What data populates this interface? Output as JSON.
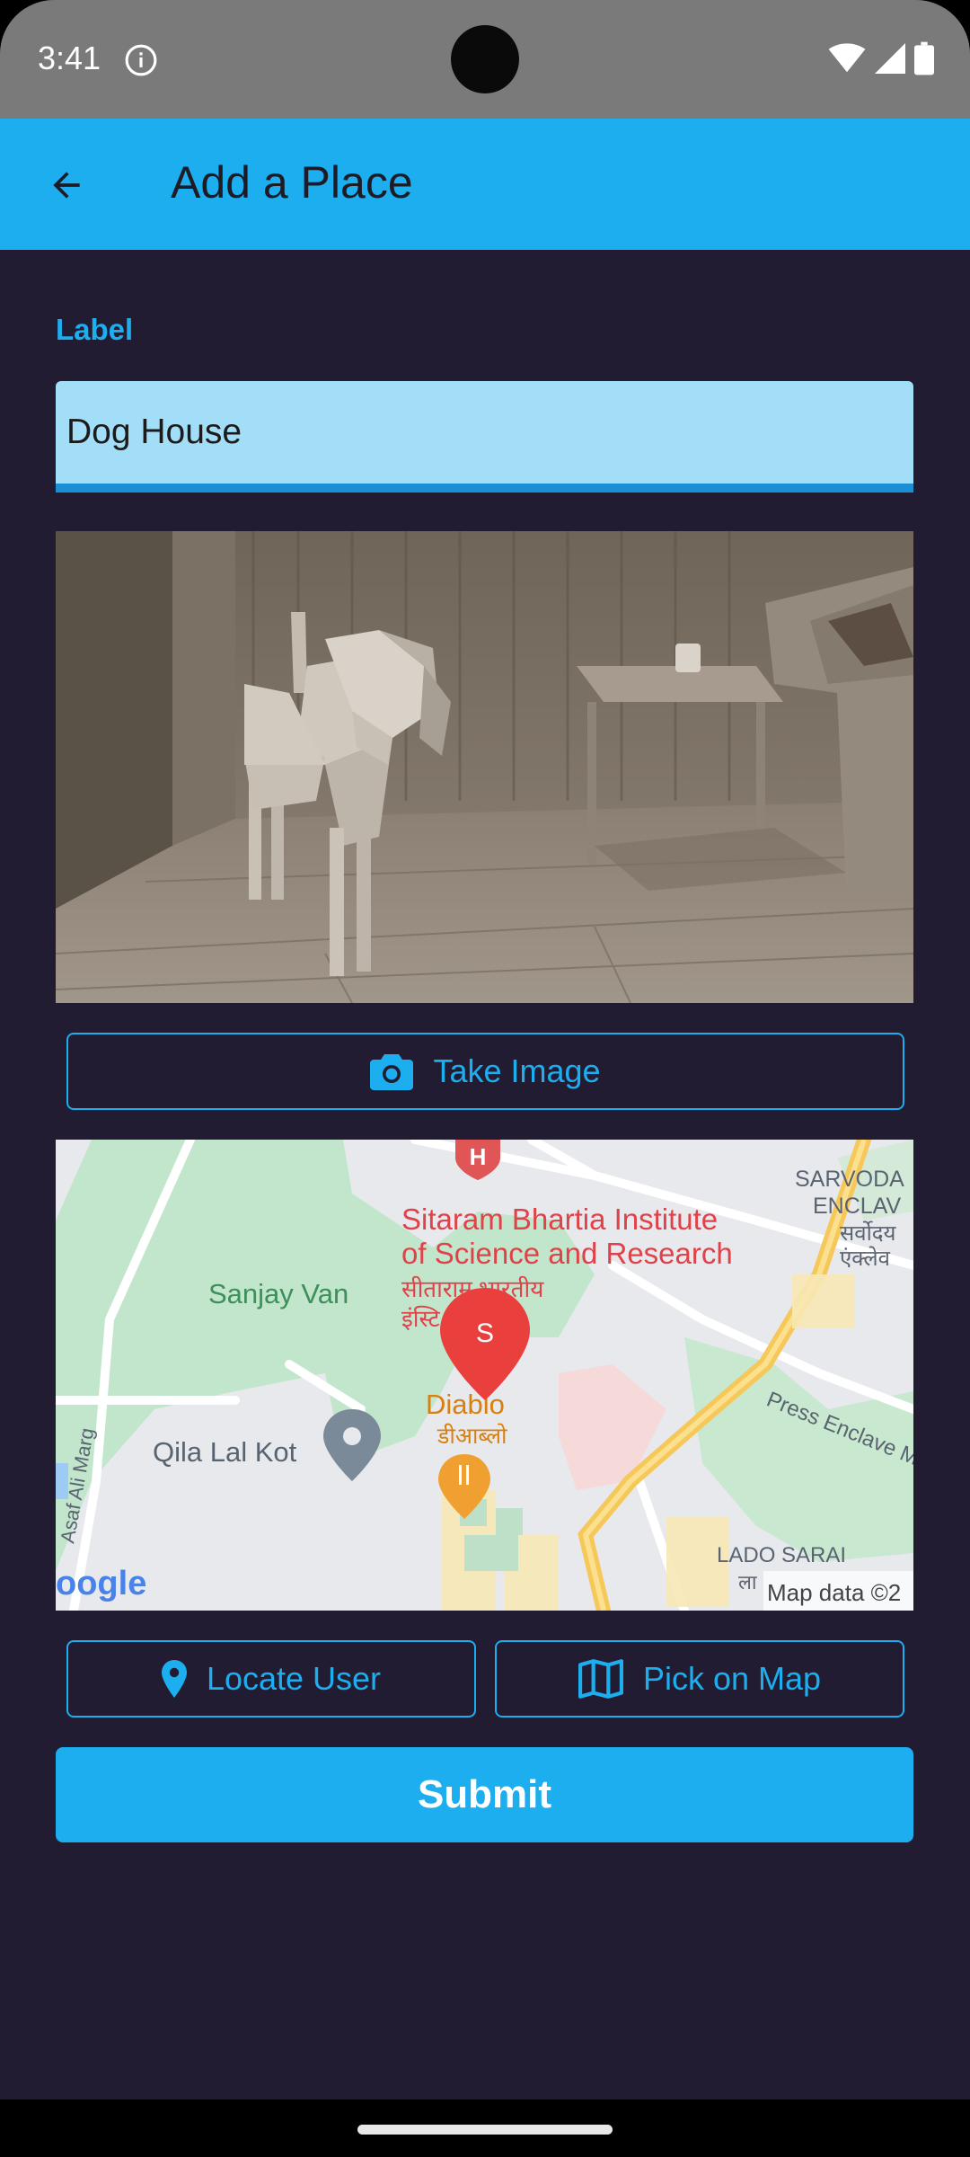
{
  "status_bar": {
    "time": "3:41",
    "icons": [
      "info-icon",
      "wifi-icon",
      "signal-icon",
      "battery-icon"
    ]
  },
  "app_bar": {
    "title": "Add a Place",
    "back_icon": "arrow-back-icon",
    "color": "#1daef0"
  },
  "form": {
    "label_heading": "Label",
    "label_value": "Dog House"
  },
  "image_preview": {
    "description_icon": "dog-photo"
  },
  "buttons": {
    "take_image": "Take Image",
    "locate_user": "Locate User",
    "pick_on_map": "Pick on Map",
    "submit": "Submit"
  },
  "map": {
    "labels": {
      "institute_line1": "Sitaram Bhartia Institute",
      "institute_line2": "of Science and Research",
      "institute_hindi1": "सीताराम भारतीय",
      "institute_hindi2": "इंस्टि",
      "sanjay_van": "Sanjay Van",
      "diablo": "Diablo",
      "diablo_hindi": "डीआब्लो",
      "qila_lal_kot": "Qila Lal Kot",
      "sarvodaya1": "SARVODA",
      "sarvodaya2": "ENCLAV",
      "sarvodaya_hindi1": "सर्वोदय",
      "sarvodaya_hindi2": "एंक्लेव",
      "press_enclave": "Press Enclave M",
      "lado_sarai": "LADO SARAI",
      "lado_hindi": "ला",
      "asaf_ali": "Asaf Ali Marg",
      "google": "oogle",
      "attribution": "Map data ©2"
    },
    "marker_letter": "S"
  },
  "colors": {
    "background": "#211c32",
    "accent": "#1daef0",
    "field_fill": "#a3def9"
  }
}
